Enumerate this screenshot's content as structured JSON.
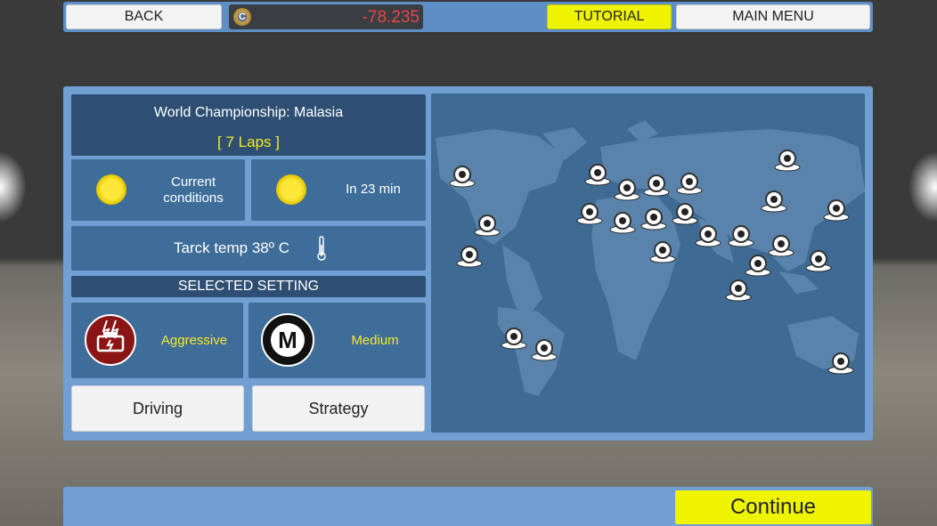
{
  "header": {
    "back_label": "BACK",
    "coin_symbol": "C",
    "money_value": "-78.235",
    "tutorial_label": "TUTORIAL",
    "main_menu_label": "MAIN MENU"
  },
  "race": {
    "title": "World Championship: Malasia",
    "laps": "[ 7 Laps ]"
  },
  "weather": {
    "current_label": "Current conditions",
    "forecast_label": "In 23 min"
  },
  "track_temp": "Tarck temp 38º C",
  "setting": {
    "header": "SELECTED SETTING",
    "driving_mode": "Aggressive",
    "strategy_mode": "Medium",
    "strategy_icon_letter": "M"
  },
  "buttons": {
    "driving": "Driving",
    "strategy": "Strategy",
    "continue": "Continue"
  },
  "colors": {
    "accent_yellow": "#eef300",
    "money_negative": "#e54848",
    "panel_blue": "#6f9fd3",
    "card_blue": "#3f6d99"
  }
}
